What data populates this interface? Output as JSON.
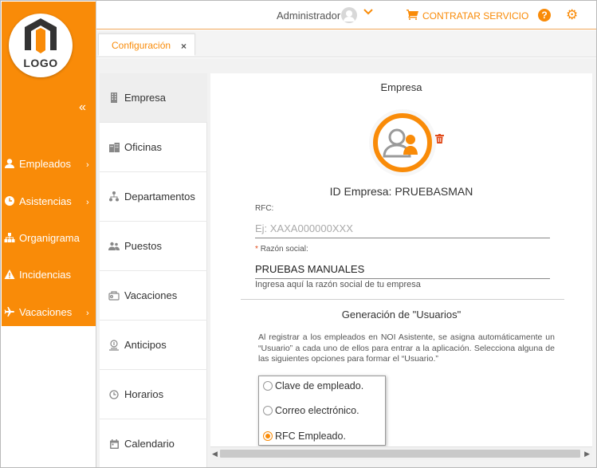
{
  "logo": {
    "text": "LOGO"
  },
  "sidebar": {
    "collapse": "«",
    "items": [
      {
        "label": "Empleados",
        "icon": "user-icon",
        "chevron": "›"
      },
      {
        "label": "Asistencias",
        "icon": "clock-icon",
        "chevron": "›"
      },
      {
        "label": "Organigrama",
        "icon": "org-chart-icon",
        "chevron": ""
      },
      {
        "label": "Incidencias",
        "icon": "warning-icon",
        "chevron": ""
      },
      {
        "label": "Vacaciones",
        "icon": "airplane-icon",
        "chevron": "›"
      }
    ]
  },
  "header": {
    "user": "Administrador",
    "contratar": "CONTRATAR SERVICIO",
    "help": "?",
    "gear": "⚙"
  },
  "tab": {
    "label": "Configuración",
    "close": "×"
  },
  "submenu": {
    "items": [
      {
        "label": "Empresa",
        "icon": "building-icon",
        "active": true
      },
      {
        "label": "Oficinas",
        "icon": "office-icon",
        "active": false
      },
      {
        "label": "Departamentos",
        "icon": "hierarchy-icon",
        "active": false
      },
      {
        "label": "Puestos",
        "icon": "people-icon",
        "active": false
      },
      {
        "label": "Vacaciones",
        "icon": "beach-icon",
        "active": false
      },
      {
        "label": "Anticipos",
        "icon": "coin-hand-icon",
        "active": false
      },
      {
        "label": "Horarios",
        "icon": "clock-icon",
        "active": false
      },
      {
        "label": "Calendario",
        "icon": "calendar-icon",
        "active": false
      }
    ]
  },
  "main": {
    "title": "Empresa",
    "id_empresa": "ID Empresa: PRUEBASMAN",
    "rfc": {
      "label": "RFC:",
      "value": "",
      "placeholder": "Ej: XAXA000000XXX"
    },
    "razon": {
      "label": "Razón social:",
      "required_mark": "*",
      "value": "PRUEBAS MANUALES",
      "helper": "Ingresa aquí la razón social de tu empresa"
    },
    "generacion_title": "Generación de \"Usuarios\"",
    "paragraph": "Al registrar a los empleados en NOI Asistente, se asigna automáticamente un “Usuario” a cada uno de ellos para entrar a la aplicación. Selecciona alguna de las siguientes opciones para formar el “Usuario.”",
    "options": [
      {
        "label": "Clave de empleado.",
        "selected": false
      },
      {
        "label": "Correo electrónico.",
        "selected": false
      },
      {
        "label": "RFC Empleado.",
        "selected": true
      }
    ]
  },
  "colors": {
    "accent": "#f98b08",
    "trash": "#e14b1b"
  }
}
